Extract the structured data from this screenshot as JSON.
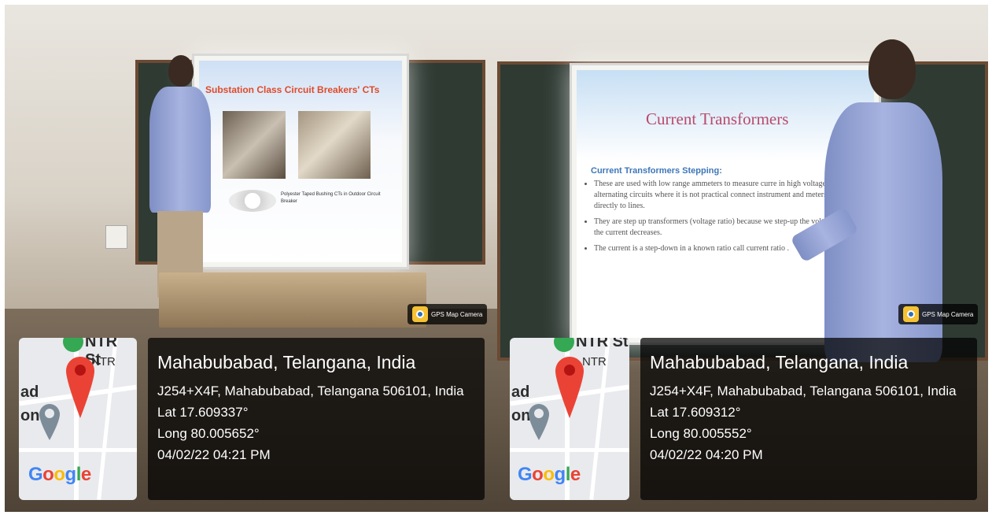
{
  "photos": [
    {
      "slide": {
        "title": "Substation Class Circuit Breakers' CTs",
        "caption": "Polyester Taped Bushing CTs in Outdoor Circuit Breaker"
      },
      "camera_badge": "GPS Map Camera",
      "map": {
        "brand": [
          "G",
          "o",
          "o",
          "g",
          "l",
          "e"
        ],
        "labels": {
          "top": "NTR St",
          "top2": "NTR",
          "left": "ad",
          "left2": "on"
        }
      },
      "info": {
        "place": "Mahabubabad, Telangana, India",
        "address": "J254+X4F, Mahabubabad, Telangana 506101, India",
        "lat": "Lat 17.609337°",
        "long": "Long 80.005652°",
        "datetime": "04/02/22 04:21 PM"
      }
    },
    {
      "slide": {
        "title": "Current Transformers",
        "subtitle": "Current Transformers Stepping:",
        "bullets": [
          "These are used with low range ammeters to measure curre in high voltage alternating circuits where it is not practical connect instrument and meters directly to lines.",
          "They are step up transformers (voltage ratio) because we step-up the voltage the current decreases.",
          "The current is a step-down in a known ratio call current ratio ."
        ]
      },
      "camera_badge": "GPS Map Camera",
      "map": {
        "brand": [
          "G",
          "o",
          "o",
          "g",
          "l",
          "e"
        ],
        "labels": {
          "top": "NTR St",
          "top2": "NTR",
          "left": "ad",
          "left2": "on"
        }
      },
      "info": {
        "place": "Mahabubabad, Telangana, India",
        "address": "J254+X4F, Mahabubabad, Telangana 506101, India",
        "lat": "Lat 17.609312°",
        "long": "Long 80.005552°",
        "datetime": "04/02/22 04:20 PM"
      }
    }
  ]
}
